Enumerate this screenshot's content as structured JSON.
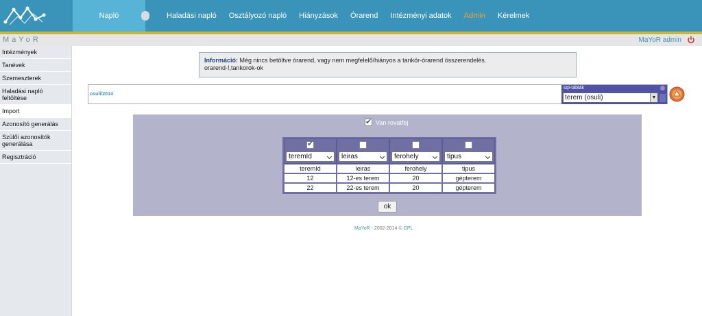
{
  "app": {
    "brand": "MaYoR"
  },
  "nav": {
    "items": [
      {
        "label": "Napló",
        "active": true
      },
      {
        "label": "Haladási napló"
      },
      {
        "label": "Osztályozó napló"
      },
      {
        "label": "Hiányzások"
      },
      {
        "label": "Órarend"
      },
      {
        "label": "Intézményi adatok"
      },
      {
        "label": "Admin",
        "highlight": true
      },
      {
        "label": "Kérelmek"
      }
    ]
  },
  "user": {
    "name": "MaYoR admin"
  },
  "sidebar": {
    "items": [
      {
        "label": "Intézmények"
      },
      {
        "label": "Tanévek"
      },
      {
        "label": "Szemeszterek"
      },
      {
        "label": "Haladási napló feltöltése"
      },
      {
        "label": "Import",
        "selected": true
      },
      {
        "label": "Azonosító generálás"
      },
      {
        "label": "Szülői azonosítók generálása"
      },
      {
        "label": "Regisztráció"
      }
    ]
  },
  "info": {
    "title": "Információ:",
    "message": "Még nincs betöltve órarend, vagy nem megfelelő/hiányos a tankör-órarend összerendelés.",
    "detail": "orarend-!,tankorok-ok"
  },
  "path": {
    "text": "osuli/2014"
  },
  "sql": {
    "title": "sql-táblák",
    "selected": "terem (osuli)"
  },
  "import": {
    "header_toggle_label": "Van rovatfej",
    "header_toggle_checked": true,
    "columns": [
      {
        "checked": true,
        "field": "teremId"
      },
      {
        "checked": false,
        "field": "leiras"
      },
      {
        "checked": false,
        "field": "ferohely"
      },
      {
        "checked": false,
        "field": "tipus"
      }
    ],
    "rows": [
      [
        "teremId",
        "leiras",
        "ferohely",
        "tipus"
      ],
      [
        "12",
        "12-es terem",
        "20",
        "gépterem"
      ],
      [
        "22",
        "22-es terem",
        "20",
        "gépterem"
      ]
    ],
    "ok_label": "ok"
  },
  "footer": {
    "brand": "MaYoR",
    "years": " - 2002-2014 © ",
    "license": "GPL"
  },
  "colors": {
    "topbar": "#3a93b9",
    "active_tab": "#58b4d6",
    "admin": "#f2a33a",
    "panel": "#b3b3cc",
    "grid": "#6f6fa3"
  }
}
